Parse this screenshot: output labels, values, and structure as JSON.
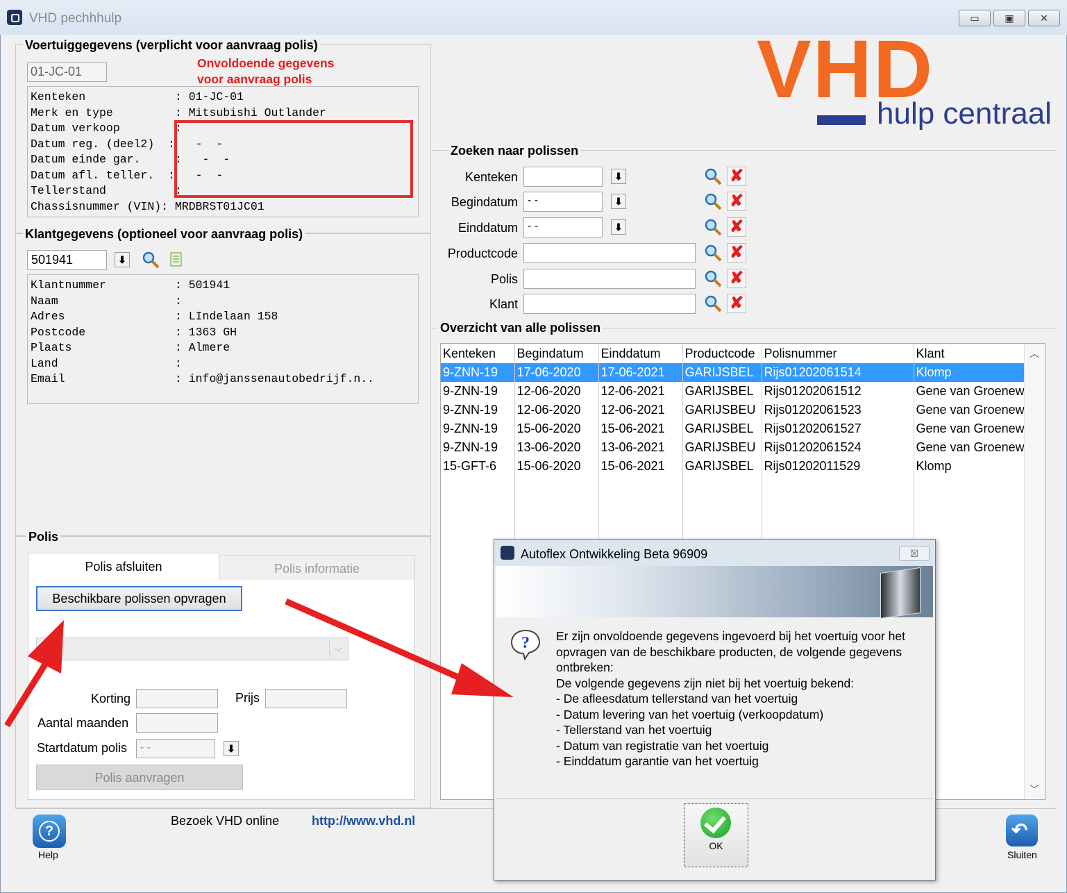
{
  "window": {
    "title": "VHD pechhhulp",
    "minimize": "▭",
    "maximize": "▣",
    "close": "✕"
  },
  "logo": {
    "big": "VHD",
    "sub": "hulp centraal",
    "brand_color": "#f26a21",
    "bar_color": "#2b3e8f"
  },
  "vehicle": {
    "group_title": "Voertuiggegevens (verplicht voor aanvraag polis)",
    "plate_value": "01-JC-01",
    "warning_line1": "Onvoldoende gegevens",
    "warning_line2": "voor aanvraag polis",
    "info_text": "Kenteken             : 01-JC-01\nMerk en type         : Mitsubishi Outlander\nDatum verkoop        :\nDatum reg. (deel2)  :   -  -\nDatum einde gar.     :   -  -\nDatum afl. teller.  :   -  -\nTellerstand          :\nChassisnummer (VIN): MRDBRST01JC01"
  },
  "customer": {
    "group_title": "Klantgegevens (optioneel voor aanvraag polis)",
    "number_value": "501941",
    "info_text": "Klantnummer          : 501941\nNaam                 :\nAdres                : LIndelaan 158\nPostcode             : 1363 GH\nPlaats               : Almere\nLand                 :\nEmail                : info@janssenautobedrijf.n.."
  },
  "search": {
    "group_title": "Zoeken naar polissen",
    "fields": [
      {
        "label": "Kenteken",
        "value": ""
      },
      {
        "label": "Begindatum",
        "value": "- -"
      },
      {
        "label": "Einddatum",
        "value": "- -"
      },
      {
        "label": "Productcode",
        "value": ""
      },
      {
        "label": "Polis",
        "value": ""
      },
      {
        "label": "Klant",
        "value": ""
      }
    ]
  },
  "overview": {
    "group_title": "Overzicht van alle polissen",
    "columns": [
      "Kenteken",
      "Begindatum",
      "Einddatum",
      "Productcode",
      "Polisnummer",
      "Klant"
    ],
    "rows": [
      [
        "9-ZNN-19",
        "17-06-2020",
        "17-06-2021",
        "GARIJSBEL",
        "Rijs01202061514",
        "Klomp"
      ],
      [
        "9-ZNN-19",
        "12-06-2020",
        "12-06-2021",
        "GARIJSBEL",
        "Rijs01202061512",
        "Gene van Groenew"
      ],
      [
        "9-ZNN-19",
        "12-06-2020",
        "12-06-2021",
        "GARIJSBEU",
        "Rijs01202061523",
        "Gene van Groenew"
      ],
      [
        "9-ZNN-19",
        "15-06-2020",
        "15-06-2021",
        "GARIJSBEL",
        "Rijs01202061527",
        "Gene van Groenew"
      ],
      [
        "9-ZNN-19",
        "13-06-2020",
        "13-06-2021",
        "GARIJSBEU",
        "Rijs01202061524",
        "Gene van Groenew"
      ],
      [
        "15-GFT-6",
        "15-06-2020",
        "15-06-2021",
        "GARIJSBEL",
        "Rijs01202011529",
        "Klomp"
      ]
    ]
  },
  "polis": {
    "group_title": "Polis",
    "tab_active": "Polis afsluiten",
    "tab_inactive": "Polis informatie",
    "request_button": "Beschikbare polissen opvragen",
    "korting_label": "Korting",
    "prijs_label": "Prijs",
    "maanden_label": "Aantal maanden",
    "startdatum_label": "Startdatum polis",
    "startdatum_value": "- -",
    "submit_button": "Polis aanvragen"
  },
  "footer": {
    "help_label": "Help",
    "visit_text": "Bezoek VHD online",
    "url": "http://www.vhd.nl",
    "close_label": "Sluiten"
  },
  "dialog": {
    "title": "Autoflex Ontwikkeling Beta 96909",
    "close": "☒",
    "message": "Er zijn onvoldoende gegevens ingevoerd bij het voertuig voor het opvragen van de beschikbare producten, de volgende gegevens ontbreken:\nDe volgende gegevens zijn niet bij het voertuig bekend:\n- De afleesdatum tellerstand van het voertuig\n- Datum levering van het voertuig (verkoopdatum)\n- Tellerstand van het voertuig\n- Datum van registratie van het voertuig\n- Einddatum garantie van het voertuig",
    "ok_label": "OK"
  },
  "colors": {
    "annotation_red": "#e03030",
    "selection_blue": "#3399ff",
    "link_blue": "#1a4fa0"
  }
}
